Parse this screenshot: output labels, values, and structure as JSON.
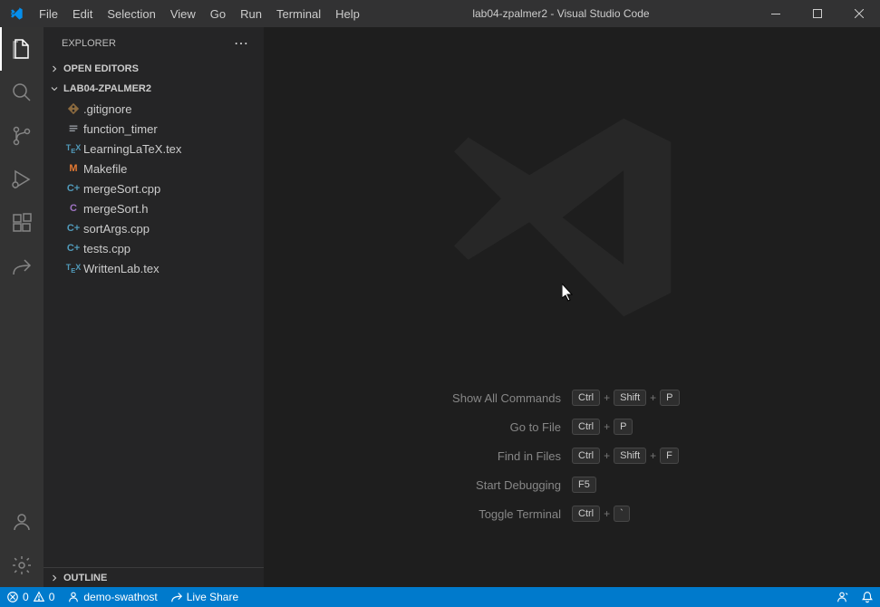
{
  "window": {
    "title": "lab04-zpalmer2 - Visual Studio Code"
  },
  "menubar": [
    "File",
    "Edit",
    "Selection",
    "View",
    "Go",
    "Run",
    "Terminal",
    "Help"
  ],
  "sidebar": {
    "title": "EXPLORER",
    "sections": {
      "openEditors": "OPEN EDITORS",
      "folder": "LAB04-ZPALMER2",
      "outline": "OUTLINE"
    },
    "files": [
      {
        "name": ".gitignore",
        "icon": "git",
        "color": "#8c6b3f"
      },
      {
        "name": "function_timer",
        "icon": "bin",
        "color": "#9aa0a6"
      },
      {
        "name": "LearningLaTeX.tex",
        "icon": "tex",
        "color": "#519aba"
      },
      {
        "name": "Makefile",
        "icon": "M",
        "color": "#e37933"
      },
      {
        "name": "mergeSort.cpp",
        "icon": "C+",
        "color": "#519aba"
      },
      {
        "name": "mergeSort.h",
        "icon": "C",
        "color": "#a074c4"
      },
      {
        "name": "sortArgs.cpp",
        "icon": "C+",
        "color": "#519aba"
      },
      {
        "name": "tests.cpp",
        "icon": "C+",
        "color": "#519aba"
      },
      {
        "name": "WrittenLab.tex",
        "icon": "tex",
        "color": "#519aba"
      }
    ]
  },
  "welcome": {
    "shortcuts": [
      {
        "label": "Show All Commands",
        "keys": [
          "Ctrl",
          "Shift",
          "P"
        ]
      },
      {
        "label": "Go to File",
        "keys": [
          "Ctrl",
          "P"
        ]
      },
      {
        "label": "Find in Files",
        "keys": [
          "Ctrl",
          "Shift",
          "F"
        ]
      },
      {
        "label": "Start Debugging",
        "keys": [
          "F5"
        ]
      },
      {
        "label": "Toggle Terminal",
        "keys": [
          "Ctrl",
          "`"
        ]
      }
    ]
  },
  "statusbar": {
    "errors": "0",
    "warnings": "0",
    "remote": "demo-swathost",
    "liveshare": "Live Share"
  }
}
